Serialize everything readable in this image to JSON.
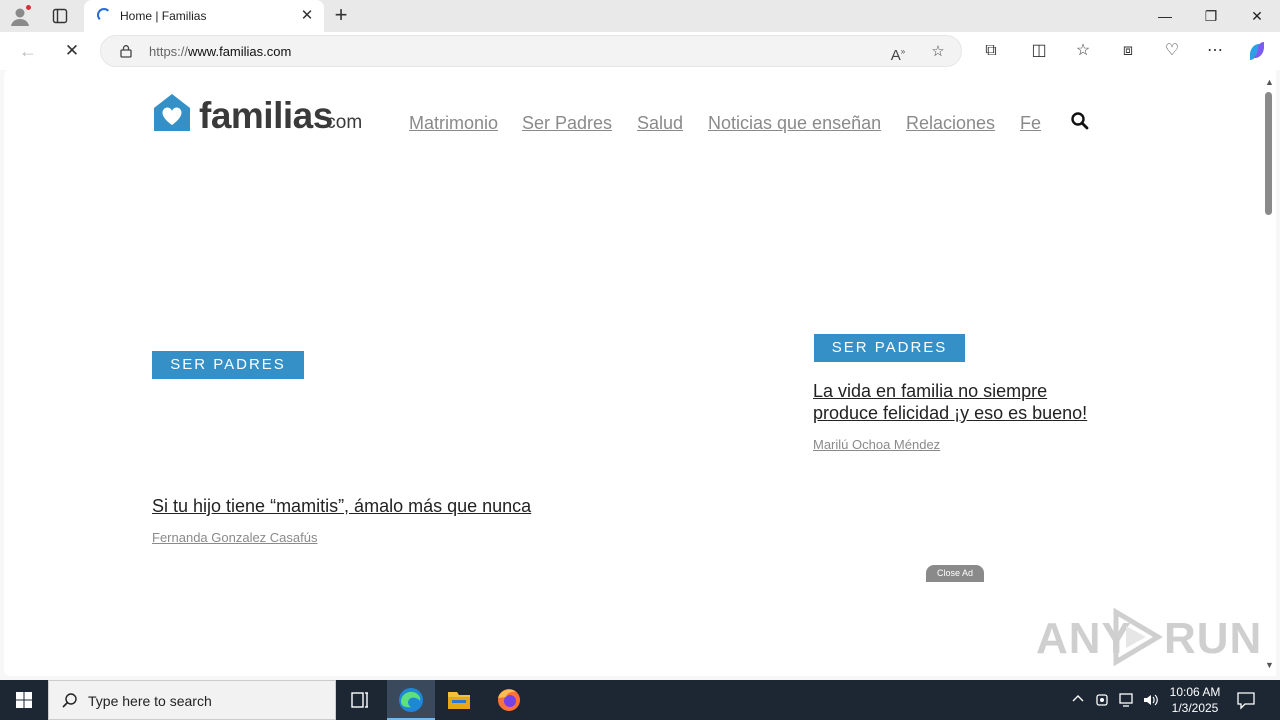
{
  "browser": {
    "tab": {
      "title": "Home | Familias"
    },
    "address": {
      "url_prefix": "https://",
      "url_host": "www.familias.com"
    }
  },
  "site": {
    "logo": {
      "word": "familias",
      "domain": ".com",
      "brand_color": "#3590c8"
    },
    "nav": [
      "Matrimonio",
      "Ser Padres",
      "Salud",
      "Noticias que enseñan",
      "Relaciones",
      "Fe"
    ],
    "articles": [
      {
        "category": "SER PADRES",
        "headline": "Si tu hijo tiene “mamitis”, ámalo más que nunca",
        "author": "Fernanda Gonzalez Casafús"
      },
      {
        "category": "SER PADRES",
        "headline_line1": "La vida en familia no siempre",
        "headline_line2": "produce felicidad ¡y eso es bueno!",
        "author": "Marilú Ochoa Méndez"
      }
    ],
    "close_ad": "Close Ad"
  },
  "watermark": {
    "left": "ANY",
    "right": "RUN"
  },
  "taskbar": {
    "search_placeholder": "Type here to search",
    "time": "10:06 AM",
    "date": "1/3/2025"
  }
}
